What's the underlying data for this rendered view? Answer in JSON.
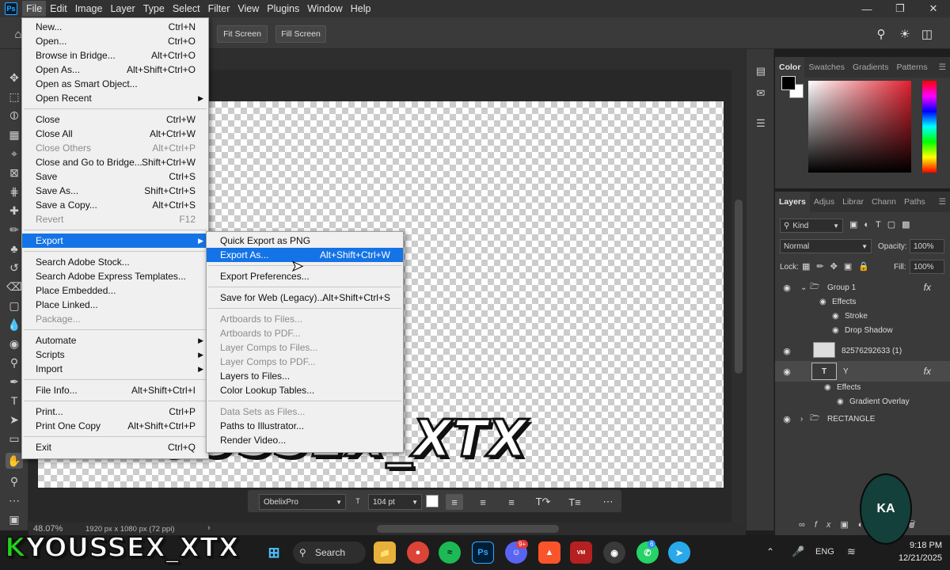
{
  "menubar": {
    "logo": "Ps",
    "items": [
      "File",
      "Edit",
      "Image",
      "Layer",
      "Type",
      "Select",
      "Filter",
      "View",
      "Plugins",
      "Window",
      "Help"
    ]
  },
  "options": {
    "fit_screen": "Fit Screen",
    "fill_screen": "Fill Screen"
  },
  "file_menu": [
    {
      "label": "New...",
      "shortcut": "Ctrl+N"
    },
    {
      "label": "Open...",
      "shortcut": "Ctrl+O"
    },
    {
      "label": "Browse in Bridge...",
      "shortcut": "Alt+Ctrl+O"
    },
    {
      "label": "Open As...",
      "shortcut": "Alt+Shift+Ctrl+O"
    },
    {
      "label": "Open as Smart Object...",
      "shortcut": ""
    },
    {
      "label": "Open Recent",
      "shortcut": ""
    },
    {
      "label": "Close",
      "shortcut": "Ctrl+W"
    },
    {
      "label": "Close All",
      "shortcut": "Alt+Ctrl+W"
    },
    {
      "label": "Close Others",
      "shortcut": "Alt+Ctrl+P"
    },
    {
      "label": "Close and Go to Bridge...",
      "shortcut": "Shift+Ctrl+W"
    },
    {
      "label": "Save",
      "shortcut": "Ctrl+S"
    },
    {
      "label": "Save As...",
      "shortcut": "Shift+Ctrl+S"
    },
    {
      "label": "Save a Copy...",
      "shortcut": "Alt+Ctrl+S"
    },
    {
      "label": "Revert",
      "shortcut": "F12"
    },
    {
      "label": "Export",
      "shortcut": ""
    },
    {
      "label": "Search Adobe Stock...",
      "shortcut": ""
    },
    {
      "label": "Search Adobe Express Templates...",
      "shortcut": ""
    },
    {
      "label": "Place Embedded...",
      "shortcut": ""
    },
    {
      "label": "Place Linked...",
      "shortcut": ""
    },
    {
      "label": "Package...",
      "shortcut": ""
    },
    {
      "label": "Automate",
      "shortcut": ""
    },
    {
      "label": "Scripts",
      "shortcut": ""
    },
    {
      "label": "Import",
      "shortcut": ""
    },
    {
      "label": "File Info...",
      "shortcut": "Alt+Shift+Ctrl+I"
    },
    {
      "label": "Print...",
      "shortcut": "Ctrl+P"
    },
    {
      "label": "Print One Copy",
      "shortcut": "Alt+Shift+Ctrl+P"
    },
    {
      "label": "Exit",
      "shortcut": "Ctrl+Q"
    }
  ],
  "export_menu": [
    {
      "label": "Quick Export as PNG",
      "shortcut": ""
    },
    {
      "label": "Export As...",
      "shortcut": "Alt+Shift+Ctrl+W"
    },
    {
      "label": "Export Preferences...",
      "shortcut": ""
    },
    {
      "label": "Save for Web (Legacy)...",
      "shortcut": "Alt+Shift+Ctrl+S"
    },
    {
      "label": "Artboards to Files...",
      "shortcut": ""
    },
    {
      "label": "Artboards to PDF...",
      "shortcut": ""
    },
    {
      "label": "Layer Comps to Files...",
      "shortcut": ""
    },
    {
      "label": "Layer Comps to PDF...",
      "shortcut": ""
    },
    {
      "label": "Layers to Files...",
      "shortcut": ""
    },
    {
      "label": "Color Lookup Tables...",
      "shortcut": ""
    },
    {
      "label": "Data Sets as Files...",
      "shortcut": ""
    },
    {
      "label": "Paths to Illustrator...",
      "shortcut": ""
    },
    {
      "label": "Render Video...",
      "shortcut": ""
    }
  ],
  "canvas": {
    "text": "YOUSSEX_XTX"
  },
  "status": {
    "zoom": "48.07%",
    "doc_info": "1920 px x 1080 px (72 ppi)"
  },
  "type_bar": {
    "font": "ObelixPro",
    "size": "104 pt"
  },
  "color_panel": {
    "tabs": [
      "Color",
      "Swatches",
      "Gradients",
      "Patterns"
    ],
    "fg": "#000000",
    "bg": "#ffffff"
  },
  "layers_panel": {
    "tabs": [
      "Layers",
      "Adjus",
      "Librar",
      "Chann",
      "Paths"
    ],
    "filter": "Kind",
    "blend": "Normal",
    "opacity_label": "Opacity:",
    "opacity": "100%",
    "lock_label": "Lock:",
    "fill_label": "Fill:",
    "fill": "100%",
    "rows": [
      {
        "name": "Group 1"
      },
      {
        "name": "Effects"
      },
      {
        "name": "Stroke"
      },
      {
        "name": "Drop Shadow"
      },
      {
        "name": "82576292633 (1)"
      },
      {
        "name": "Y"
      },
      {
        "name": "Effects"
      },
      {
        "name": "Gradient Overlay"
      },
      {
        "name": "RECTANGLE"
      }
    ]
  },
  "taskbar": {
    "search": "Search",
    "lang": "ENG",
    "time": "9:18 PM",
    "date": "12/21/2025",
    "discord_badge": "9+",
    "telegram_badge": "6"
  },
  "overlay": {
    "prefix": "K",
    "name": "YOUSSEX_XTX"
  },
  "watermark": {
    "text": "KA"
  }
}
